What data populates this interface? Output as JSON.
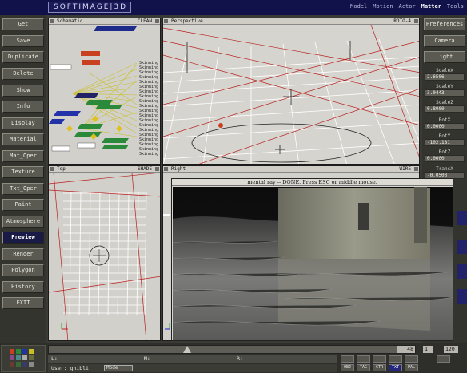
{
  "app": {
    "logo": "SOFTIMAGE|3D"
  },
  "modules": [
    "Model",
    "Motion",
    "Actor",
    "Matter",
    "Tools"
  ],
  "active_module": "Matter",
  "left_menu": [
    "Get",
    "Save",
    "Duplicate",
    "Delete",
    "Show",
    "Info",
    "Display",
    "Material",
    "Mat_Oper",
    "Texture",
    "Txt_Oper",
    "Paint",
    "Atmosphere",
    "Preview",
    "Render",
    "Polygon",
    "History",
    "EXIT"
  ],
  "selected_left": "Preview",
  "right_menu": {
    "preferences": "Preferences",
    "camera": "Camera",
    "light": "Light"
  },
  "transforms": [
    {
      "label": "ScaleX",
      "value": "2.6506"
    },
    {
      "label": "ScaleY",
      "value": "3.0443"
    },
    {
      "label": "ScaleZ",
      "value": "0.8000"
    },
    {
      "label": "RotX",
      "value": "0.0000"
    },
    {
      "label": "RotY",
      "value": "-102.181"
    },
    {
      "label": "RotZ",
      "value": "0.0000"
    },
    {
      "label": "TransX",
      "value": "-0.0503"
    }
  ],
  "viewports": {
    "schematic": {
      "title": "Schematic",
      "mode": "CLEAN"
    },
    "perspective": {
      "title": "Perspective",
      "mode": "ROTO-4"
    },
    "top": {
      "title": "Top",
      "mode": "SHADE"
    },
    "right": {
      "title": "Right",
      "mode": "WIRE"
    }
  },
  "schematic_labels": [
    "Skinning",
    "Skinning",
    "Skinning",
    "Skinning",
    "Skinning",
    "Skinning",
    "Skinning",
    "Skinning",
    "Skinning",
    "Skinning",
    "Skinning",
    "Skinning",
    "Skinning",
    "Skinning",
    "Skinning",
    "Skinning",
    "Skinning",
    "Skinning",
    "Skinning",
    "Skinning",
    "Skinning",
    "Skinning",
    "Skinning",
    "Skinning"
  ],
  "render_window": {
    "title": "mental ray -- DONE. Press ESC or middle mouse."
  },
  "timeline": {
    "current_frame": "48",
    "start": "1",
    "end": "120"
  },
  "status": {
    "left": "L:",
    "middle": "M:",
    "right": "R:"
  },
  "user": {
    "label": "User: ghibli",
    "mode": "Mode"
  },
  "bottom_buttons": [
    "OBJ",
    "TAG",
    "CTR",
    "TXT",
    "PAL"
  ],
  "active_bottom": "TXT",
  "colors": {
    "title_bg": "#12124a",
    "panel": "#34342f",
    "button": "#5a5a52",
    "selected": "#1a1a46",
    "viewport": "#d2d0ca"
  }
}
